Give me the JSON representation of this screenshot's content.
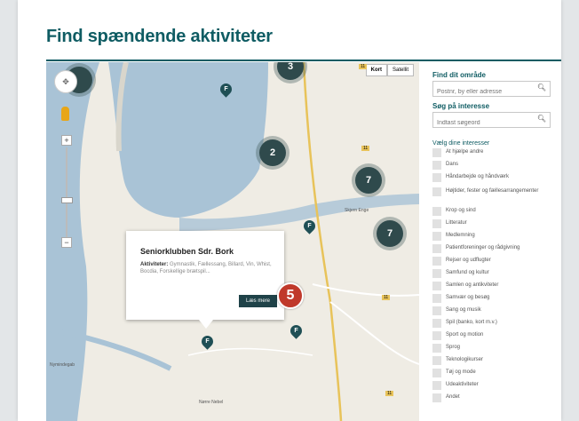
{
  "page_title": "Find spændende aktiviteter",
  "map": {
    "map_types": [
      "Kort",
      "Satellit"
    ],
    "clusters": [
      {
        "label": "3"
      },
      {
        "label": "2"
      },
      {
        "label": "7"
      },
      {
        "label": "7"
      },
      {
        "label": ""
      }
    ],
    "pin_letter": "F",
    "place_labels": [
      "Skjern Enge",
      "Nymindegab",
      "Nørre Nebel"
    ],
    "road_numbers": [
      "11",
      "11",
      "11",
      "11"
    ],
    "popup": {
      "title": "Seniorklubben Sdr. Bork",
      "activities_label": "Aktiviteter:",
      "activities": "Gymnastik, Fællessang, Billard, Vin, Whist, Bocdia, Forskellige brætspil...",
      "button": "Læs mere"
    },
    "callout_number": "5"
  },
  "sidebar": {
    "area_heading": "Find dit område",
    "area_placeholder": "Postnr, by eller adresse",
    "interest_heading": "Søg på interesse",
    "interest_placeholder": "Indtast søgeord",
    "choose_heading": "Vælg dine interesser",
    "interests": [
      "At hjælpe andre",
      "Dans",
      "Håndarbejde og håndværk",
      "Højtider, fester og fællesarrangementer",
      "Krop og sind",
      "Litteratur",
      "Medlemning",
      "Patientforeninger og rådgivning",
      "Rejser og udflugter",
      "Samfund og kultur",
      "Samlen og antikviteter",
      "Samvær og besøg",
      "Sang og musik",
      "Spil (banko, kort m.v.)",
      "Sport og motion",
      "Sprog",
      "Teknologikurser",
      "Tøj og mode",
      "Udeaktiviteter",
      "Andet"
    ]
  },
  "colors": {
    "accent": "#0f5c63",
    "cluster": "#2f4a4c",
    "callout": "#c0392b",
    "water": "#a9c3d6"
  }
}
